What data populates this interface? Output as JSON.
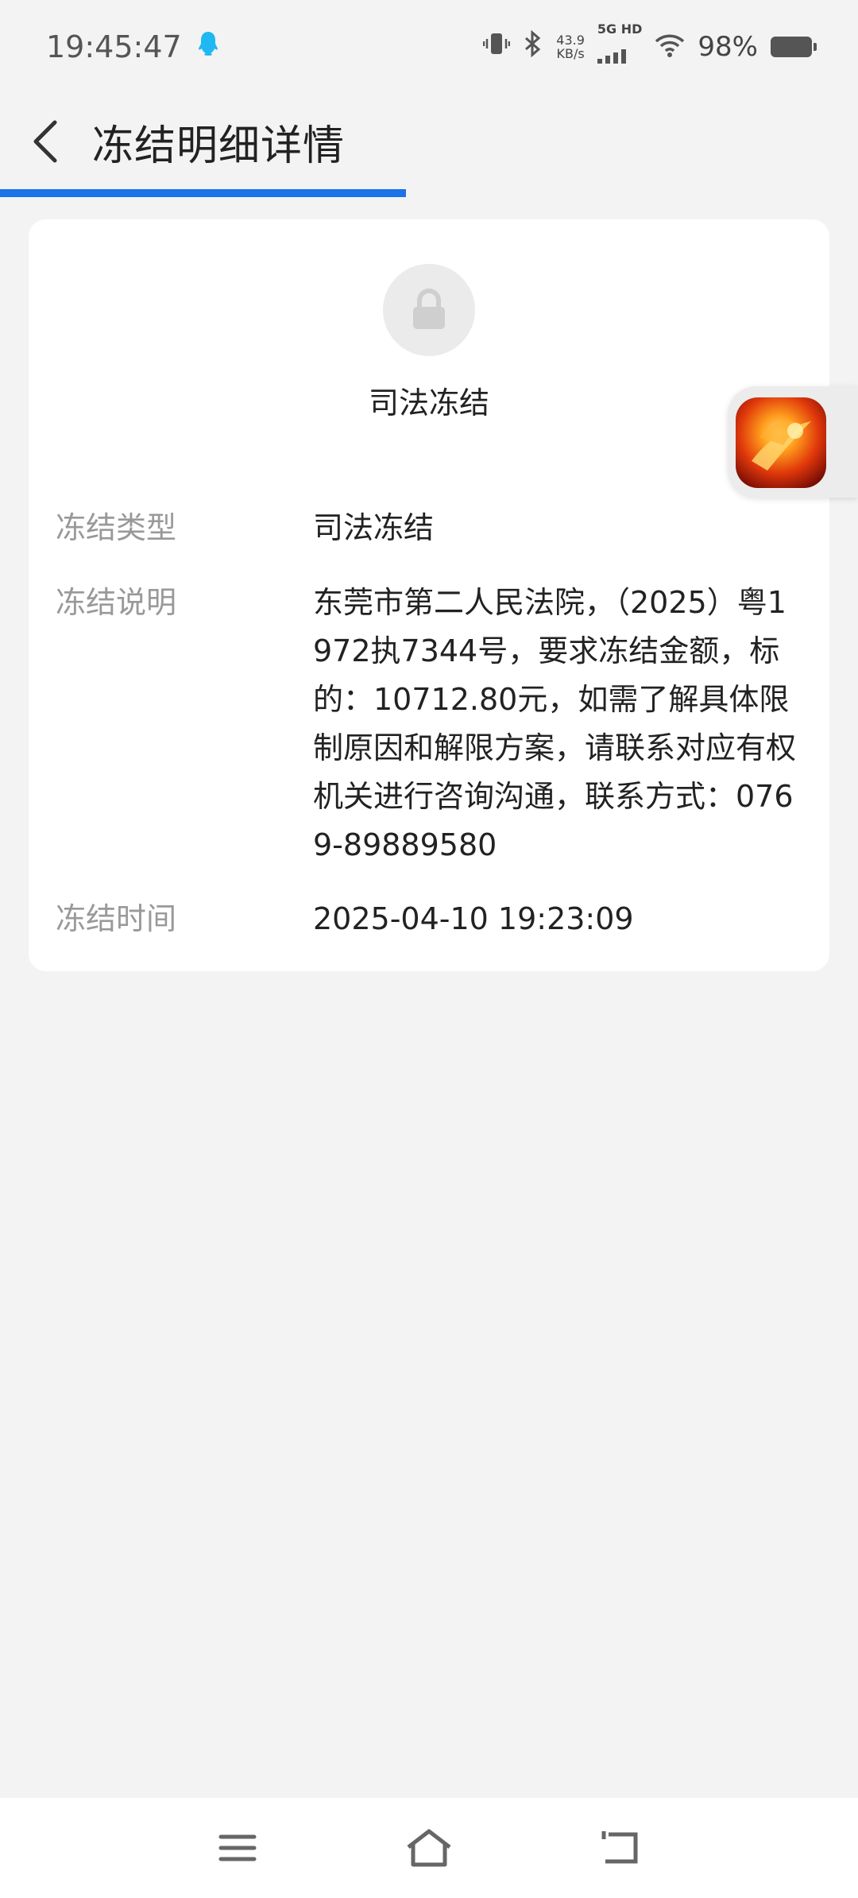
{
  "status_bar": {
    "time": "19:45:47",
    "net_speed_value": "43.9",
    "net_speed_unit": "KB/s",
    "network_label": "5G HD",
    "battery_percent": "98%",
    "icons": [
      "qq-icon",
      "vibrate-icon",
      "bluetooth-icon",
      "signal-icon",
      "wifi-icon",
      "battery-icon"
    ]
  },
  "header": {
    "title": "冻结明细详情",
    "back_icon": "chevron-left-icon"
  },
  "progress": {
    "fraction": 0.473,
    "color": "#1a73e8"
  },
  "card": {
    "status_icon": "lock-icon",
    "status_title": "司法冻结",
    "rows": [
      {
        "label": "冻结类型",
        "value": "司法冻结"
      },
      {
        "label": "冻结说明",
        "value": "东莞市第二人民法院，（2025）粤1972执7344号，要求冻结金额，标的：10712.80元，如需了解具体限制原因和解限方案，请联系对应有权机关进行咨询沟通，联系方式：0769-89889580"
      },
      {
        "label": "冻结时间",
        "value": "2025-04-10 19:23:09"
      }
    ]
  },
  "floating_app": {
    "icon": "game-app-icon"
  },
  "nav_bar": {
    "icons": [
      "menu-icon",
      "home-icon",
      "back-icon"
    ]
  }
}
